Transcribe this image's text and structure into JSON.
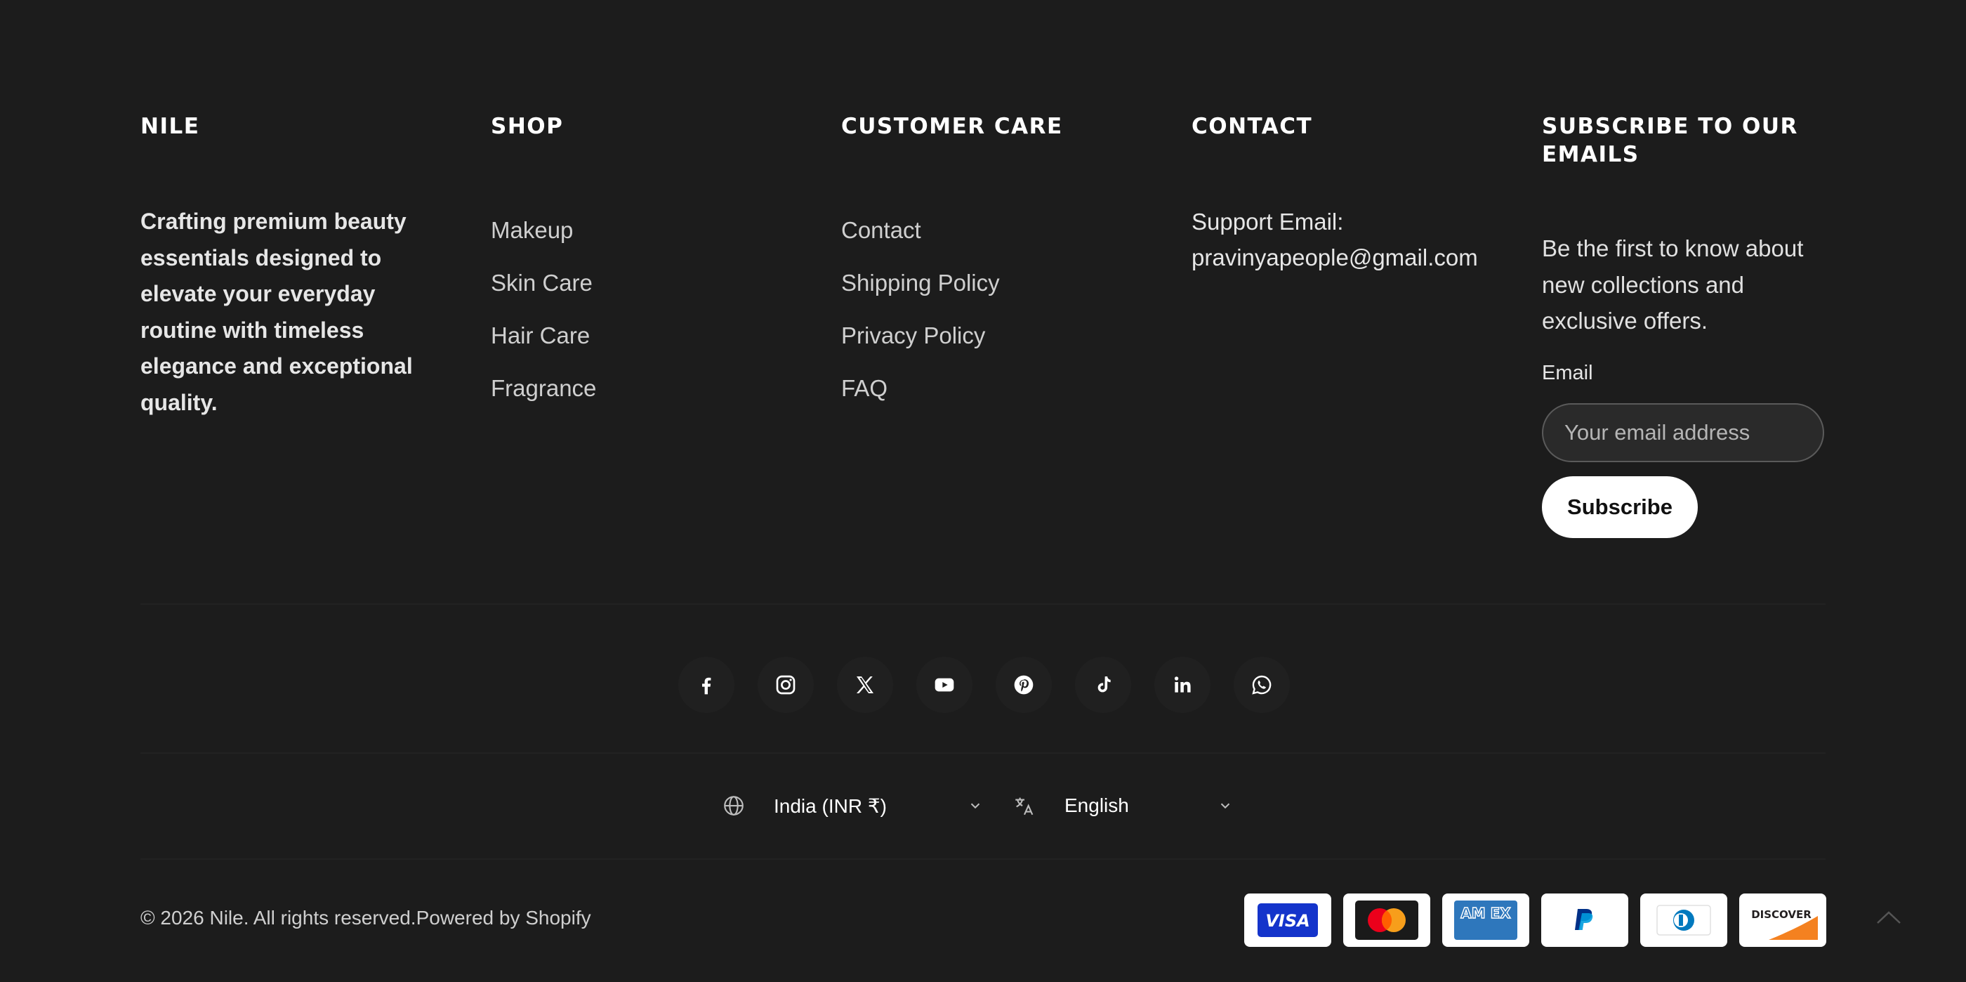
{
  "about": {
    "title": "NILE",
    "text": "Crafting premium beauty essentials designed to elevate your everyday routine with timeless elegance and exceptional quality."
  },
  "shop": {
    "title": "SHOP",
    "links": [
      "Makeup",
      "Skin Care",
      "Hair Care",
      "Fragrance"
    ]
  },
  "customer_care": {
    "title": "CUSTOMER CARE",
    "links": [
      "Contact",
      "Shipping Policy",
      "Privacy Policy",
      "FAQ"
    ]
  },
  "contact": {
    "title": "CONTACT",
    "label": "Support Email:",
    "email": "pravinyapeople@gmail.com"
  },
  "newsletter": {
    "title": "SUBSCRIBE TO OUR EMAILS",
    "text": "Be the first to know about new collections and exclusive offers.",
    "email_label": "Email",
    "email_placeholder": "Your email address",
    "email_value": "",
    "button": "Subscribe"
  },
  "social": [
    "facebook-icon",
    "instagram-icon",
    "x-icon",
    "youtube-icon",
    "pinterest-icon",
    "tiktok-icon",
    "linkedin-icon",
    "whatsapp-icon"
  ],
  "locale": {
    "country": "India (INR ₹)",
    "language": "English"
  },
  "copyright": "© 2026 Nile. All rights reserved.Powered by Shopify",
  "payments": {
    "visa": "VISA",
    "amex": "AM EX",
    "discover": "DISCOVER"
  },
  "colors": {
    "background": "#1c1c1c",
    "heading": "#ffffff",
    "text": "#d9d9d9",
    "visa": "#1434cb",
    "amex": "#2e77bc",
    "paypal": "#003087",
    "mastercard_red": "#eb001b",
    "mastercard_orange": "#f79e1b",
    "discover_orange": "#f48120"
  }
}
